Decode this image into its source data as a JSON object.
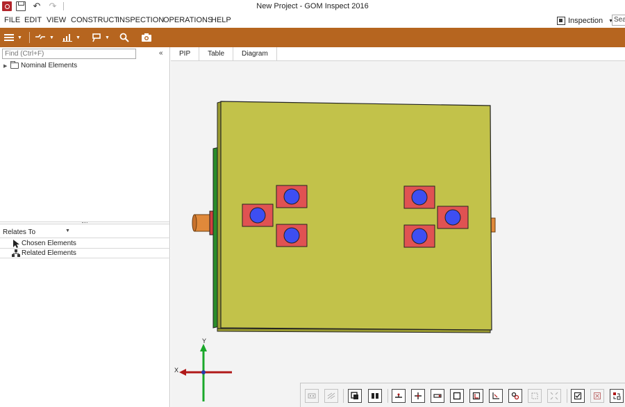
{
  "window": {
    "title": "New Project - GOM Inspect 2016"
  },
  "menu": {
    "items": [
      "FILE",
      "EDIT",
      "VIEW",
      "CONSTRUCT",
      "INSPECTION",
      "OPERATIONS",
      "HELP"
    ]
  },
  "workspace": {
    "label": "Inspection"
  },
  "search": {
    "value": "Sear"
  },
  "explorer": {
    "find_placeholder": "Find (Ctrl+F)",
    "collapse_label": "«",
    "tree": {
      "label": "Nominal Elements"
    }
  },
  "relates": {
    "label": "Relates To",
    "items": [
      "Chosen Elements",
      "Related Elements"
    ]
  },
  "tabs": [
    "PIP",
    "Table",
    "Diagram"
  ],
  "axes": {
    "x_label": "X",
    "y_label": "Y"
  },
  "colors": {
    "accent": "#b6651f",
    "plate": "#c2c24a",
    "pad": "#e05252",
    "hole": "#3d4ef2",
    "pin": "#e0893a",
    "axis_x": "#b01818",
    "axis_y": "#1aa82a"
  }
}
